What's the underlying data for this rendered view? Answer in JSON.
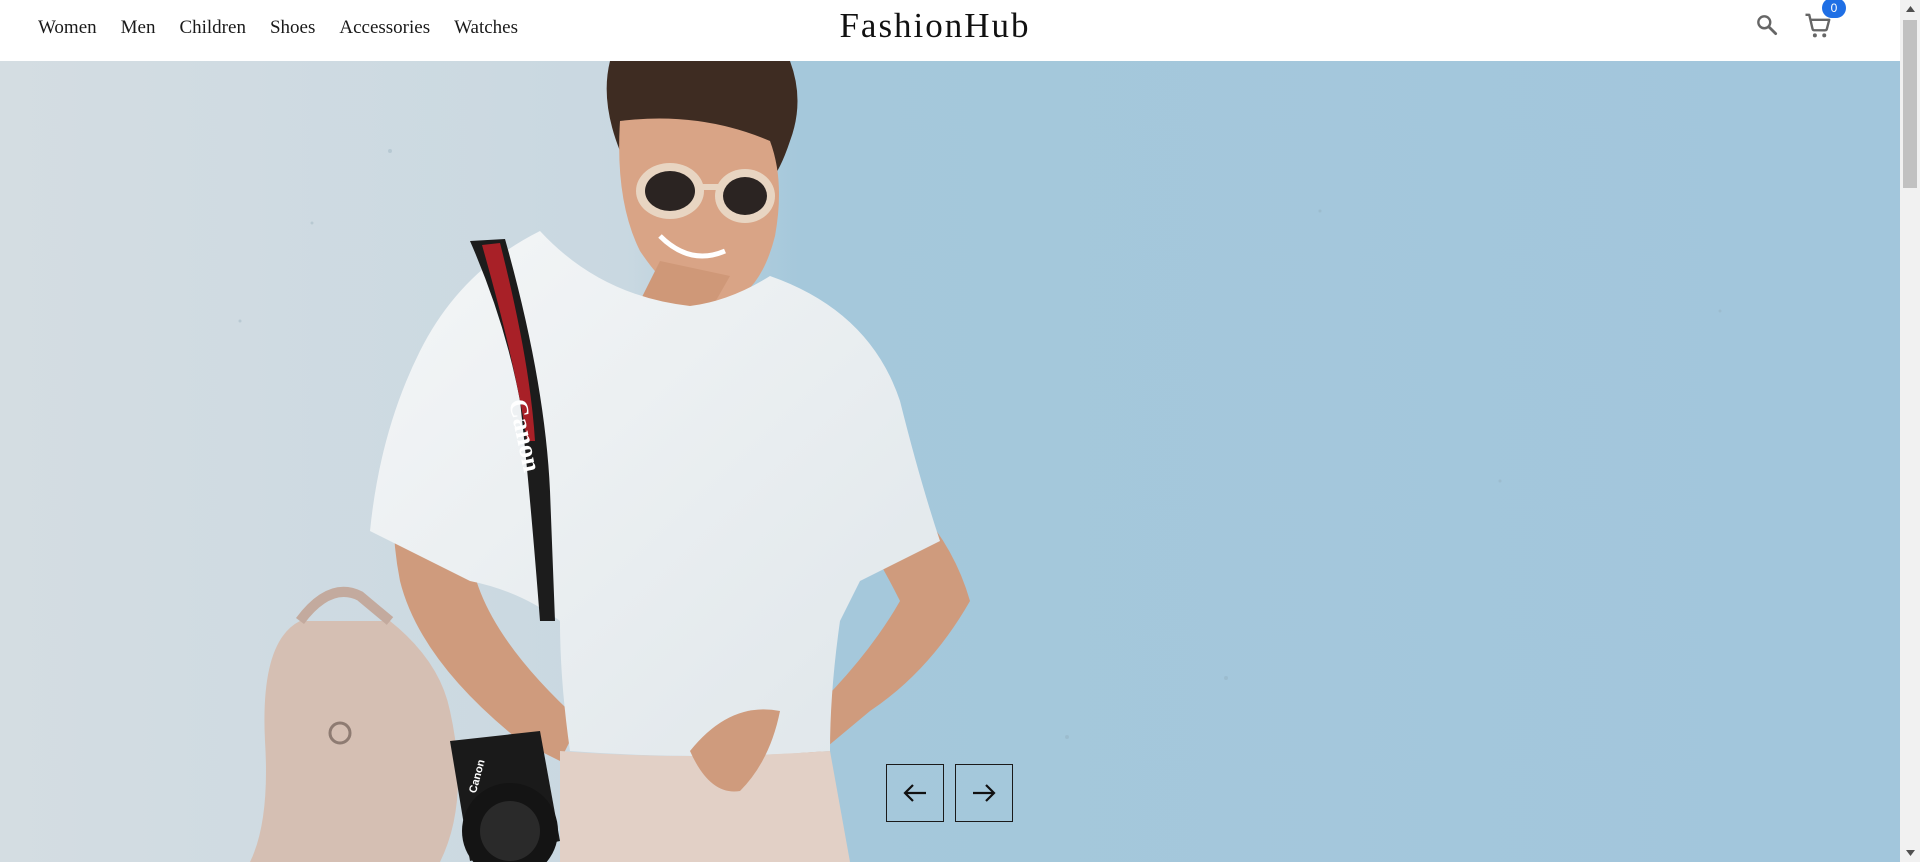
{
  "header": {
    "brand": "FashionHub",
    "nav": [
      {
        "label": "Women"
      },
      {
        "label": "Men"
      },
      {
        "label": "Children"
      },
      {
        "label": "Shoes"
      },
      {
        "label": "Accessories"
      },
      {
        "label": "Watches"
      }
    ],
    "cart_count": "0",
    "icons": {
      "search": "search-icon",
      "cart": "cart-icon"
    }
  },
  "hero": {
    "image": "woman-white-tshirt-camera-blue-wall",
    "strap_text": "Canon",
    "camera_text": "Canon",
    "controls": {
      "prev": "arrow-left-icon",
      "next": "arrow-right-icon"
    }
  },
  "colors": {
    "badge": "#1f6fe5",
    "wall": "#a9cde0",
    "shirt": "#eef1f3"
  }
}
